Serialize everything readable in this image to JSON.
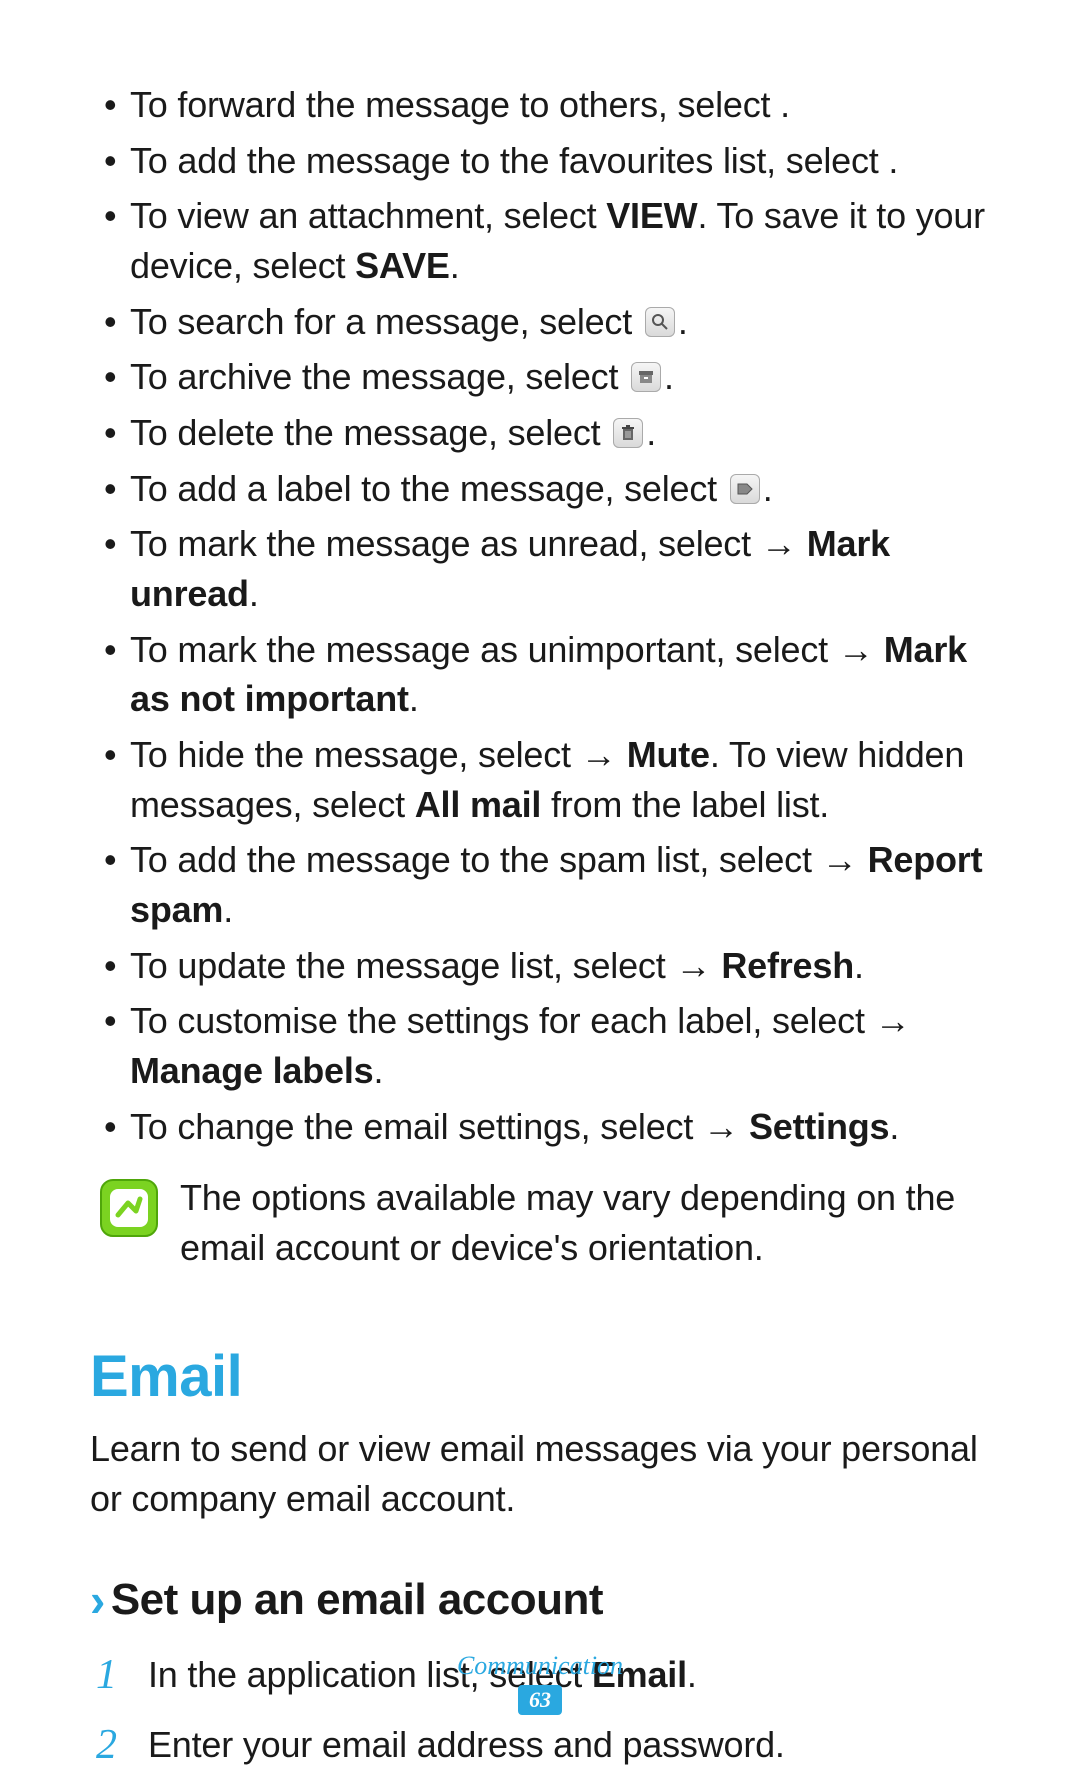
{
  "bullets": {
    "forward_pre": "To forward the message to others, select ",
    "forward_post": ".",
    "fav_pre": "To add the message to the favourites list, select ",
    "fav_post": ".",
    "attach_pre": "To view an attachment, select ",
    "attach_view": "VIEW",
    "attach_mid": ". To save it to your device, select ",
    "attach_save": "SAVE",
    "attach_post": ".",
    "search_pre": "To search for a message, select ",
    "search_post": ".",
    "archive_pre": "To archive the message, select ",
    "archive_post": ".",
    "delete_pre": "To delete the message, select ",
    "delete_post": ".",
    "label_pre": "To add a label to the message, select ",
    "label_post": ".",
    "unread_pre": "To mark the message as unread, select ",
    "unread_arrow": " → ",
    "unread_bold": "Mark unread",
    "unread_post": ".",
    "unimp_pre": "To mark the message as unimportant, select ",
    "unimp_arrow": " → ",
    "unimp_bold": "Mark as not important",
    "unimp_post": ".",
    "hide_pre": "To hide the message, select ",
    "hide_arrow": " → ",
    "hide_bold": "Mute",
    "hide_mid": ". To view hidden messages, select ",
    "hide_allmail": "All mail",
    "hide_post": " from the label list.",
    "spam_pre": "To add the message to the spam list, select ",
    "spam_arrow": " → ",
    "spam_bold": "Report spam",
    "spam_post": ".",
    "refresh_pre": "To update the message list, select ",
    "refresh_arrow": " → ",
    "refresh_bold": "Refresh",
    "refresh_post": ".",
    "managelabels_pre": "To customise the settings for each label, select ",
    "managelabels_arrow": " → ",
    "managelabels_bold": "Manage labels",
    "managelabels_post": ".",
    "settings_pre": "To change the email settings, select ",
    "settings_arrow": " → ",
    "settings_bold": "Settings",
    "settings_post": "."
  },
  "note": "The options available may vary depending on the email account or device's orientation.",
  "section_title": "Email",
  "section_intro": "Learn to send or view email messages via your personal or company email account.",
  "subsection_title": "Set up an email account",
  "step1_pre": "In the application list, select ",
  "step1_bold": "Email",
  "step1_post": ".",
  "step2": "Enter your email address and password.",
  "footer_label": "Communication",
  "page_number": "63"
}
